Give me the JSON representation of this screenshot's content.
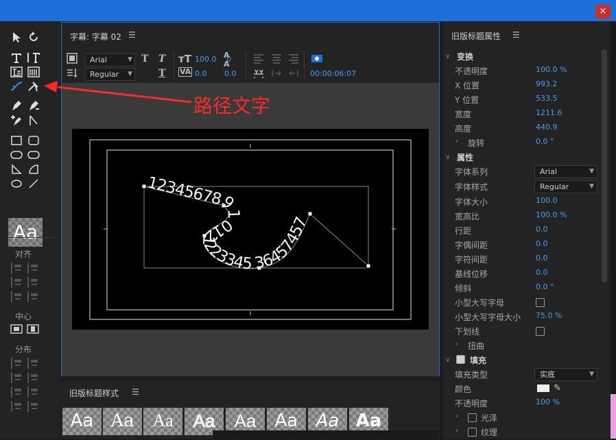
{
  "window": {
    "close_glyph": "×",
    "accent": "#1f6fd8",
    "close_color": "#c9302c"
  },
  "tools": {
    "aa_tile": "Aa",
    "align_label": "对齐",
    "center_label": "中心",
    "distribute_label": "分布"
  },
  "title_panel": {
    "title": "字幕: 字幕 02",
    "menu_icon": "hamburger-icon",
    "font_family": "Arial",
    "font_style": "Regular",
    "font_size": "100.0",
    "tracking": "0.0",
    "kerning_value": "0.0",
    "leading_value": "0",
    "timecode": "00:00:06:07",
    "path_text": "12345678910121223345 36457457"
  },
  "annotation": {
    "text": "路径文字",
    "color": "#ff2a2a"
  },
  "styles_panel": {
    "title": "旧版标题样式",
    "swatch_label": "Aa"
  },
  "properties": {
    "title": "旧版标题属性",
    "transform": {
      "header": "变换",
      "opacity_label": "不透明度",
      "opacity": "100.0 %",
      "x_label": "X 位置",
      "x": "993.2",
      "y_label": "Y 位置",
      "y": "533.5",
      "width_label": "宽度",
      "width": "1211.6",
      "height_label": "高度",
      "height": "440.9",
      "rotation_label": "旋转",
      "rotation": "0.0 °"
    },
    "attributes": {
      "header": "属性",
      "font_family_label": "字体系列",
      "font_family": "Arial",
      "font_style_label": "字体样式",
      "font_style": "Regular",
      "font_size_label": "字体大小",
      "font_size": "100.0",
      "aspect_label": "宽高比",
      "aspect": "100.0 %",
      "leading_label": "行距",
      "leading": "0.0",
      "kerning_label": "字偶间距",
      "kerning": "0.0",
      "tracking_label": "字符间距",
      "tracking": "0.0",
      "baseline_label": "基线位移",
      "baseline": "0.0",
      "slant_label": "倾斜",
      "slant": "0.0 °",
      "smallcaps_label": "小型大写字母",
      "smallcaps_size_label": "小型大写字母大小",
      "smallcaps_size": "75.0 %",
      "underline_label": "下划线",
      "distort_label": "扭曲"
    },
    "fill": {
      "header": "填充",
      "type_label": "填充类型",
      "type": "实底",
      "color_label": "颜色",
      "opacity_label": "不透明度",
      "opacity": "100 %",
      "sheen_label": "光泽",
      "texture_label": "纹理"
    }
  }
}
